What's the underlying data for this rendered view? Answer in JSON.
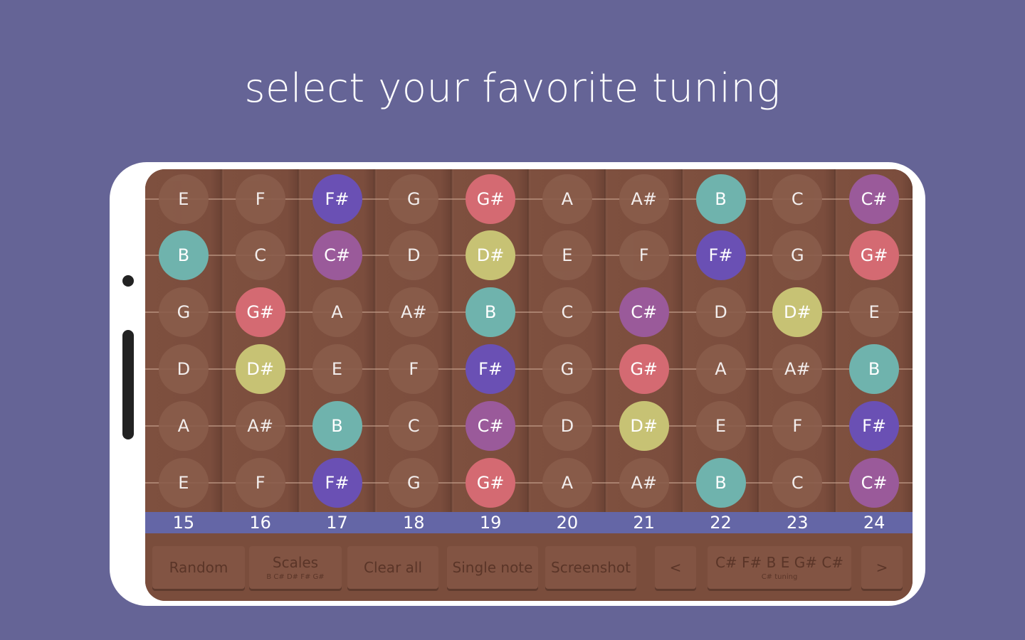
{
  "headline": "select your favorite tuning",
  "colors": {
    "background": "#656496",
    "neutral": "#8a5d4b",
    "F#": "#6a50b4",
    "G#": "#d46a72",
    "B": "#6fb3ad",
    "C#": "#9a5a9a",
    "D#": "#c7c274"
  },
  "fretboard": {
    "frets": [
      "15",
      "16",
      "17",
      "18",
      "19",
      "20",
      "21",
      "22",
      "23",
      "24"
    ],
    "strings": [
      [
        "E",
        "F",
        "F#",
        "G",
        "G#",
        "A",
        "A#",
        "B",
        "C",
        "C#"
      ],
      [
        "B",
        "C",
        "C#",
        "D",
        "D#",
        "E",
        "F",
        "F#",
        "G",
        "G#"
      ],
      [
        "G",
        "G#",
        "A",
        "A#",
        "B",
        "C",
        "C#",
        "D",
        "D#",
        "E"
      ],
      [
        "D",
        "D#",
        "E",
        "F",
        "F#",
        "G",
        "G#",
        "A",
        "A#",
        "B"
      ],
      [
        "A",
        "A#",
        "B",
        "C",
        "C#",
        "D",
        "D#",
        "E",
        "F",
        "F#"
      ],
      [
        "E",
        "F",
        "F#",
        "G",
        "G#",
        "A",
        "A#",
        "B",
        "C",
        "C#"
      ]
    ],
    "highlighted": [
      "F#",
      "G#",
      "B",
      "C#",
      "D#"
    ]
  },
  "toolbar": {
    "random": "Random",
    "scales": "Scales",
    "scales_sub": "B C# D# F# G#",
    "clear_all": "Clear all",
    "single_note": "Single note",
    "screenshot": "Screenshot",
    "prev": "<",
    "tuning": "C# F# B E G# C#",
    "tuning_sub": "C# tuning",
    "next": ">"
  }
}
